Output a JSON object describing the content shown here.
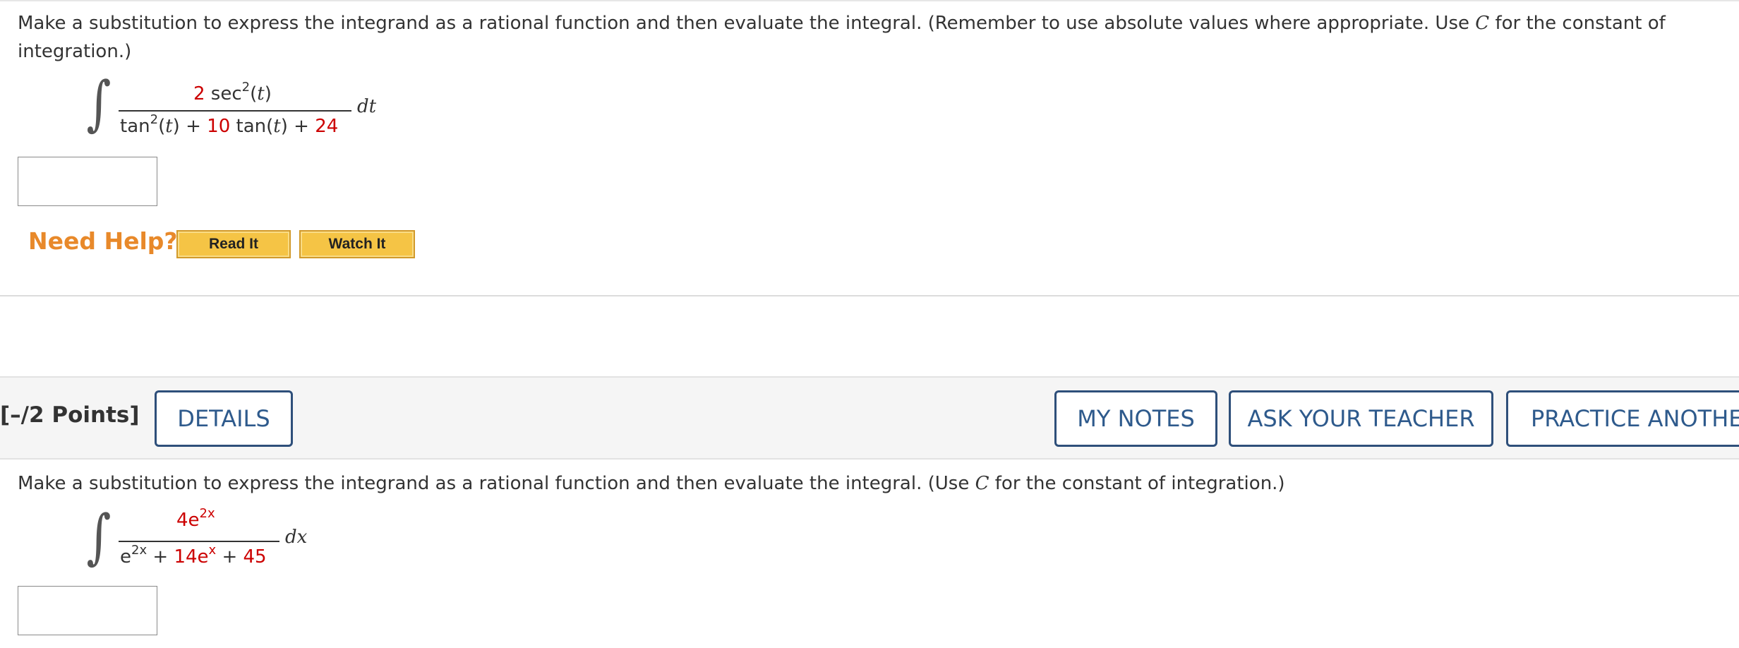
{
  "q1": {
    "prompt_pre": "Make a substitution to express the integrand as a rational function and then evaluate the integral. (Remember to use absolute values where appropriate. Use ",
    "prompt_var": "C",
    "prompt_post": " for the constant of integration.)",
    "integral_sign": "∫",
    "numerator": {
      "coef": "2",
      "func": " sec",
      "exp": "2",
      "arg": "(t)"
    },
    "denominator": {
      "t1_func": "tan",
      "t1_exp": "2",
      "t1_arg": "(t)",
      "plus1": " + ",
      "coef2": "10",
      "t2": " tan(t)",
      "plus2": " + ",
      "const": "24"
    },
    "differential": "dt"
  },
  "help": {
    "label": "Need Help?",
    "read_it": "Read It",
    "watch_it": "Watch It"
  },
  "q2_header": {
    "points": "[–/2 Points]",
    "details": "DETAILS",
    "my_notes": "MY NOTES",
    "ask_teacher": "ASK YOUR TEACHER",
    "practice": "PRACTICE ANOTHER"
  },
  "q2": {
    "prompt_pre": "Make a substitution to express the integrand as a rational function and then evaluate the integral. (Use ",
    "prompt_var": "C",
    "prompt_post": " for the constant of integration.)",
    "integral_sign": "∫",
    "numerator": {
      "coef": "4",
      "base": "e",
      "exp": "2x"
    },
    "denominator": {
      "t1_base": "e",
      "t1_exp": "2x",
      "plus1": " + ",
      "coef2": "14",
      "t2_base": "e",
      "t2_exp": "x",
      "plus2": " + ",
      "const": "45"
    },
    "differential": "dx"
  },
  "colors": {
    "accent_red": "#cc0000",
    "help_orange": "#e8892a",
    "button_blue": "#2e5a8c"
  }
}
